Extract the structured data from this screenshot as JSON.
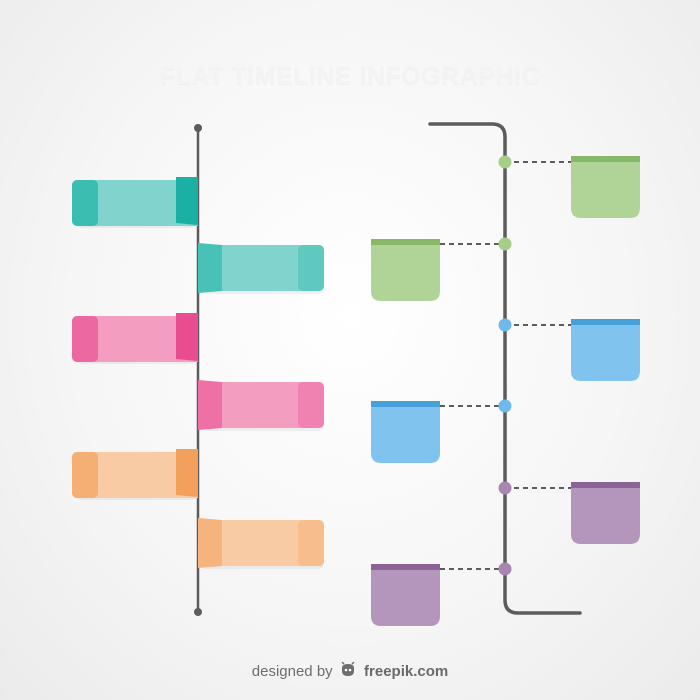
{
  "infographic": {
    "title": "FLAT TIMELINE INFOGRAPHIC",
    "colors": {
      "teal": "#1ab1a4",
      "pink": "#e94d8f",
      "orange": "#f3a05c",
      "green": "#8ec26a",
      "blue": "#4aa9e6",
      "purple": "#94689f",
      "line": "#5c5c5c",
      "background": "#f7f7f7"
    },
    "left_timeline": {
      "left_banners": [
        {
          "color_name": "teal"
        },
        {
          "color_name": "pink"
        },
        {
          "color_name": "orange"
        }
      ],
      "right_banners": [
        {
          "color_name": "teal"
        },
        {
          "color_name": "pink"
        },
        {
          "color_name": "orange"
        }
      ]
    },
    "right_timeline": {
      "nodes": [
        {
          "color_name": "green",
          "card_side": "right"
        },
        {
          "color_name": "green",
          "card_side": "left"
        },
        {
          "color_name": "blue",
          "card_side": "right"
        },
        {
          "color_name": "blue",
          "card_side": "left"
        },
        {
          "color_name": "purple",
          "card_side": "right"
        },
        {
          "color_name": "purple",
          "card_side": "left"
        }
      ]
    }
  },
  "footer": {
    "designed_by": "designed by",
    "brand": "freepik.com",
    "logo_icon": "freepik-logo-icon"
  }
}
